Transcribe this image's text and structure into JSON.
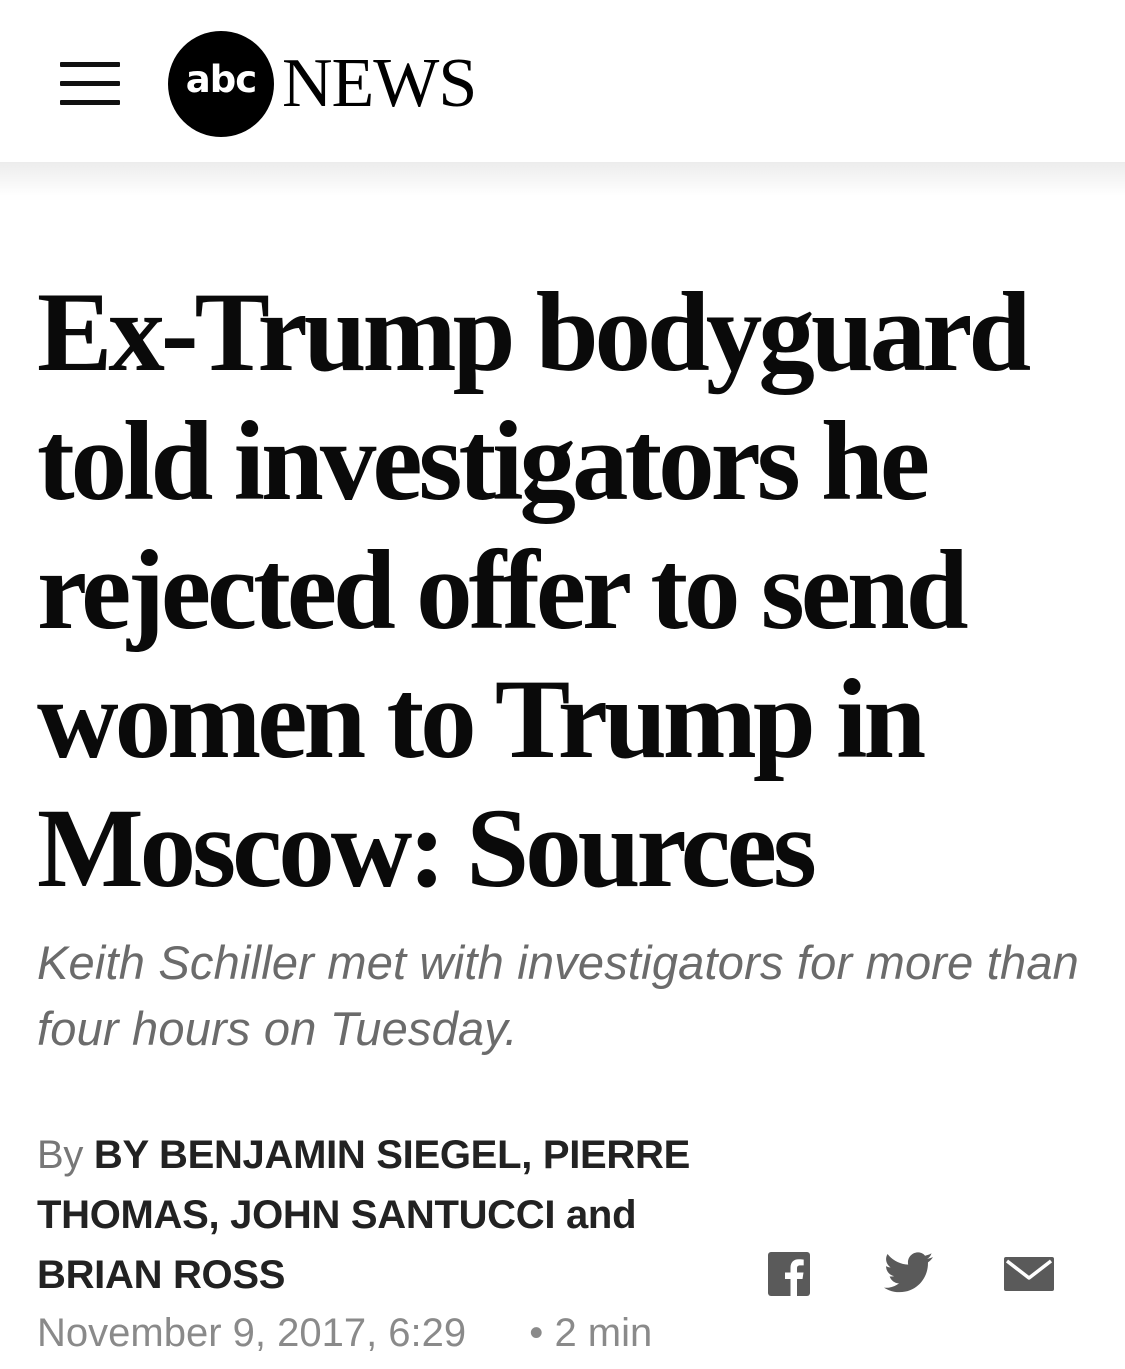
{
  "header": {
    "logo_abc": "abc",
    "logo_news": "NEWS",
    "menu_icon": "hamburger-menu-icon"
  },
  "article": {
    "headline": "Ex-Trump bodyguard told investigators he rejected offer to send women to Trump in Moscow: Sources",
    "subheadline": "Keith Schiller met with investigators for more than four hours on Tuesday.",
    "byline_prefix": "By",
    "authors": "BY BENJAMIN SIEGEL, PIERRE THOMAS, JOHN SANTUCCI",
    "authors_joiner": "and",
    "last_author": "BRIAN ROSS",
    "date": "November 9, 2017, 6:29",
    "read_time_separator": "•",
    "read_time": "2 min"
  },
  "share": {
    "icons": [
      "facebook-icon",
      "twitter-icon",
      "email-icon"
    ],
    "icon_color": "#5a5a5a"
  },
  "colors": {
    "headline": "#0a0a0a",
    "subheadline": "#6b6b6b",
    "meta": "#8a8a8a"
  }
}
